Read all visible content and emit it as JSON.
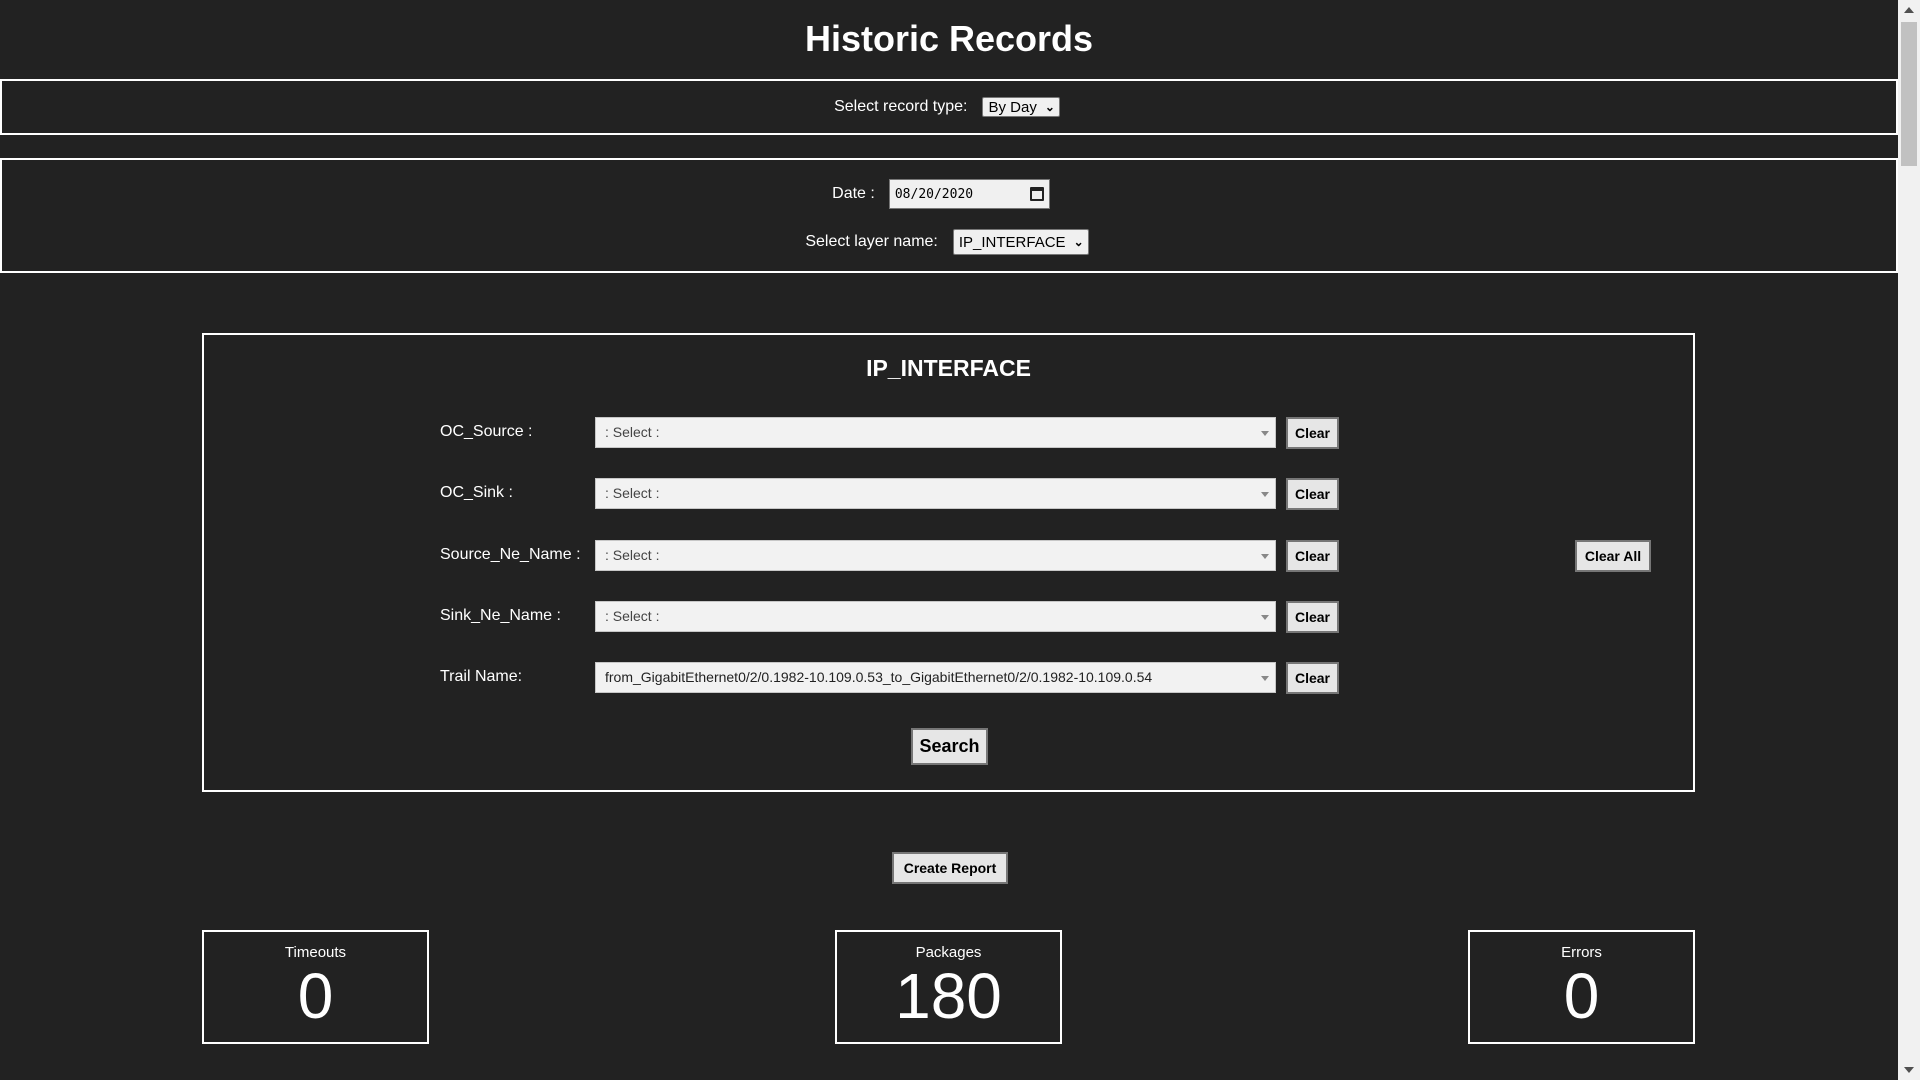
{
  "page": {
    "title": "Historic Records"
  },
  "record_type": {
    "label": "Select record type:",
    "selected": "By Day"
  },
  "date": {
    "label": "Date :",
    "value": "08/20/2020"
  },
  "layer": {
    "label": "Select layer name:",
    "selected": "IP_INTERFACE"
  },
  "panel": {
    "title": "IP_INTERFACE",
    "fields": [
      {
        "label": "OC_Source :",
        "value": ": Select :",
        "clear": "Clear"
      },
      {
        "label": "OC_Sink :",
        "value": ": Select :",
        "clear": "Clear"
      },
      {
        "label": "Source_Ne_Name :",
        "value": ": Select :",
        "clear": "Clear"
      },
      {
        "label": "Sink_Ne_Name :",
        "value": ": Select :",
        "clear": "Clear"
      },
      {
        "label": "Trail Name:",
        "value": "from_GigabitEthernet0/2/0.1982-10.109.0.53_to_GigabitEthernet0/2/0.1982-10.109.0.54",
        "clear": "Clear"
      }
    ],
    "clear_all": "Clear All",
    "search": "Search"
  },
  "actions": {
    "create_report": "Create Report"
  },
  "stats": [
    {
      "label": "Timeouts",
      "value": "0"
    },
    {
      "label": "Packages",
      "value": "180"
    },
    {
      "label": "Errors",
      "value": "0"
    }
  ],
  "colors": {
    "background": "#222222",
    "border": "#ffffff",
    "text": "#ffffff"
  }
}
